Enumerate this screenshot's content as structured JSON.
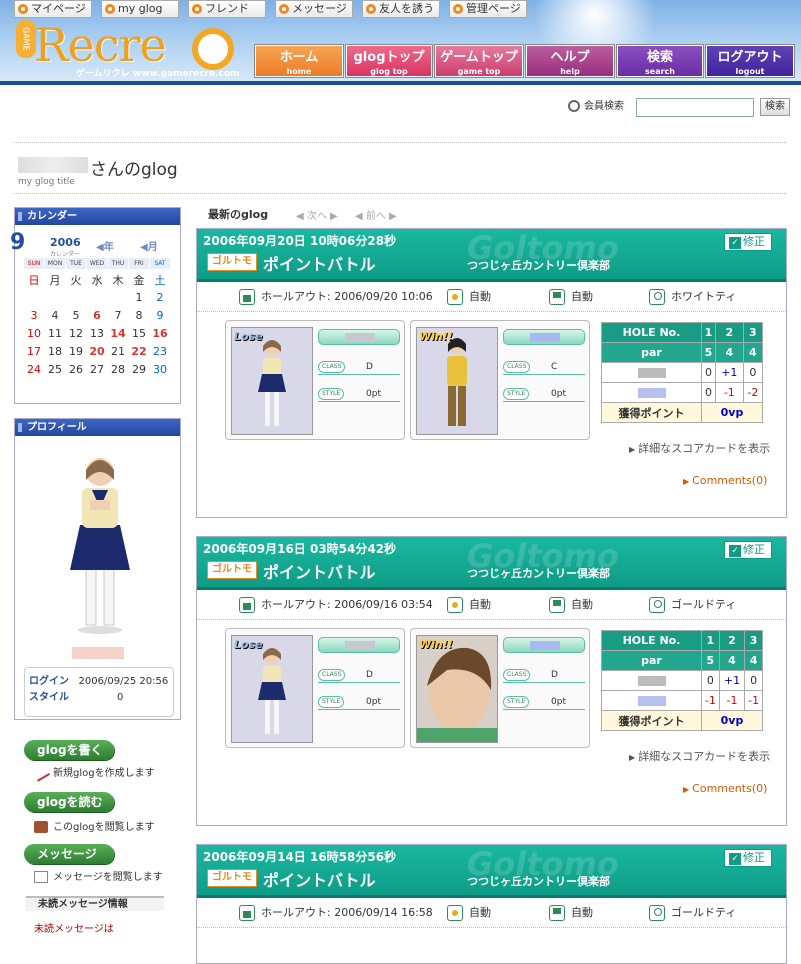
{
  "header": {
    "logo_text": "Recre",
    "logo_game": "GAME",
    "logo_sub": "ゲームリクレ www.gamerecre.com",
    "nav": [
      {
        "label": "ホーム",
        "sub": "home"
      },
      {
        "label": "glogトップ",
        "sub": "glog top"
      },
      {
        "label": "ゲームトップ",
        "sub": "game top"
      },
      {
        "label": "ヘルプ",
        "sub": "help"
      },
      {
        "label": "検索",
        "sub": "search"
      },
      {
        "label": "ログアウト",
        "sub": "logout"
      }
    ]
  },
  "subnav": [
    "マイページ",
    "my glog",
    "フレンド",
    "メッセージ",
    "友人を誘う",
    "管理ページ"
  ],
  "member_search": {
    "label": "会員検索",
    "button": "検索",
    "value": ""
  },
  "page": {
    "title": "さんのglog",
    "subtitle": "my glog title"
  },
  "calendar": {
    "title": "カレンダー",
    "month": "9",
    "year": "2006",
    "year_label": "カレンダー",
    "prev": "◀年",
    "next": "◀月",
    "weekdays_en": [
      "SUN",
      "MON",
      "TUE",
      "WED",
      "THU",
      "FRI",
      "SAT"
    ],
    "weekdays_jp": [
      "日",
      "月",
      "火",
      "水",
      "木",
      "金",
      "土"
    ],
    "days": [
      "1",
      "2",
      "3",
      "4",
      "5",
      "6",
      "7",
      "8",
      "9",
      "10",
      "11",
      "12",
      "13",
      "14",
      "15",
      "16",
      "17",
      "18",
      "19",
      "20",
      "21",
      "22",
      "23",
      "24",
      "25",
      "26",
      "27",
      "28",
      "29",
      "30"
    ],
    "highlight": [
      "6",
      "14",
      "16",
      "20",
      "22"
    ]
  },
  "profile": {
    "title": "プロフィール",
    "login_label": "ログイン",
    "login_value": "2006/09/25 20:56",
    "style_label": "スタイル",
    "style_value": "0"
  },
  "sidebar_actions": [
    {
      "button": "glogを書く",
      "sub": "新規glogを作成します"
    },
    {
      "button": "glogを読む",
      "sub": "このglogを閲覧します"
    },
    {
      "button": "メッセージ",
      "sub": "メッセージを閲覧します"
    }
  ],
  "unread": {
    "title": "未読メッセージ情報",
    "item": "未読メッセージは"
  },
  "main": {
    "heading": "最新のglog",
    "next": "次へ",
    "prev": "前へ"
  },
  "posts": [
    {
      "date": "2006年09月20日 10時06分28秒",
      "type": "ポイントバトル",
      "club": "つつじヶ丘カントリー倶楽部",
      "edit": "修正",
      "holeout": "ホールアウト: 2006/09/20 10:06",
      "mode1": "自動",
      "mode2": "自動",
      "tee": "ホワイトティ",
      "loser": {
        "badge": "Lose",
        "class": "D",
        "style": "0pt"
      },
      "winner": {
        "badge": "Win!!",
        "class": "C",
        "style": "0pt"
      },
      "holes": [
        "1",
        "2",
        "3"
      ],
      "par": [
        "5",
        "4",
        "4"
      ],
      "p1": [
        "0",
        "+1",
        "0"
      ],
      "p2": [
        "0",
        "-1",
        "-2"
      ],
      "points": "0vp",
      "detail": "詳細なスコアカードを表示",
      "comments": "Comments(0)"
    },
    {
      "date": "2006年09月16日 03時54分42秒",
      "type": "ポイントバトル",
      "club": "つつじヶ丘カントリー倶楽部",
      "edit": "修正",
      "holeout": "ホールアウト: 2006/09/16 03:54",
      "mode1": "自動",
      "mode2": "自動",
      "tee": "ゴールドティ",
      "loser": {
        "badge": "Lose",
        "class": "D",
        "style": "0pt"
      },
      "winner": {
        "badge": "Win!!",
        "class": "D",
        "style": "0pt"
      },
      "holes": [
        "1",
        "2",
        "3"
      ],
      "par": [
        "5",
        "4",
        "4"
      ],
      "p1": [
        "0",
        "+1",
        "0"
      ],
      "p2": [
        "-1",
        "-1",
        "-1"
      ],
      "points": "0vp",
      "detail": "詳細なスコアカードを表示",
      "comments": "Comments(0)"
    },
    {
      "date": "2006年09月14日 16時58分56秒",
      "type": "ポイントバトル",
      "club": "つつじヶ丘カントリー倶楽部",
      "edit": "修正",
      "holeout": "ホールアウト: 2006/09/14 16:58",
      "mode1": "自動",
      "mode2": "自動",
      "tee": "ゴールドティ"
    }
  ],
  "labels": {
    "hole_no": "HOLE No.",
    "par": "par",
    "points": "獲得ポイント",
    "class": "CLASS",
    "style": "STYLE",
    "logo": "ゴルトモ",
    "watermark": "Goltomo"
  }
}
